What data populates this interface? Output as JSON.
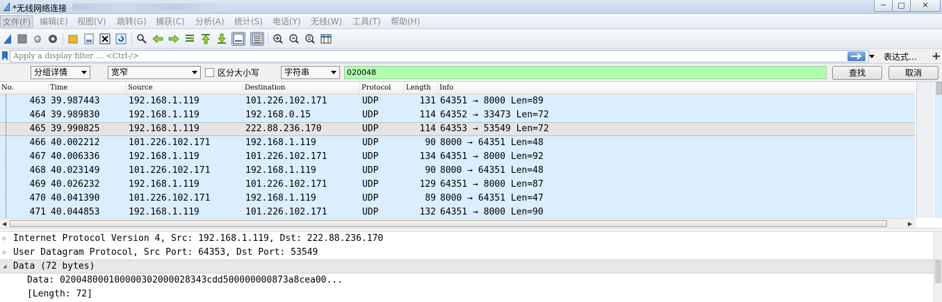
{
  "window": {
    "title": "*无线网络连接",
    "controls": {
      "minimize": "─",
      "maximize": "□",
      "close": "✕"
    }
  },
  "menubar": {
    "items": [
      "文件(F)",
      "编辑(E)",
      "视图(V)",
      "跳转(G)",
      "捕获(C)",
      "分析(A)",
      "统计(S)",
      "电话(Y)",
      "无线(W)",
      "工具(T)",
      "帮助(H)"
    ]
  },
  "toolbar": {
    "buttons": [
      "start-capture-icon",
      "stop-capture-icon",
      "restart-capture-icon",
      "capture-options-icon",
      "open-file-icon",
      "save-file-icon",
      "close-file-icon",
      "reload-icon",
      "find-packet-icon",
      "go-back-icon",
      "go-forward-icon",
      "go-to-packet-icon",
      "go-first-icon",
      "go-last-icon",
      "autoscroll-icon",
      "colorize-icon",
      "zoom-in-icon",
      "zoom-out-icon",
      "zoom-normal-icon",
      "resize-columns-icon"
    ]
  },
  "filter": {
    "placeholder": "Apply a display filter … <Ctrl-/>",
    "expression_label": "表达式…",
    "add_label": "+"
  },
  "find": {
    "search_in": "分组详情",
    "charset": "宽窄",
    "case_sensitive_label": "区分大小写",
    "search_type": "字符串",
    "search_value": "020048",
    "find_button": "查找",
    "cancel_button": "取消"
  },
  "packet_list": {
    "columns": [
      "No.",
      "Time",
      "Source",
      "Destination",
      "Protocol",
      "Length",
      "Info"
    ],
    "rows": [
      {
        "no": "463",
        "time": "39.987443",
        "src": "192.168.1.119",
        "dst": "101.226.102.171",
        "proto": "UDP",
        "len": "131",
        "info": "64351 → 8000 Len=89",
        "selected": false
      },
      {
        "no": "464",
        "time": "39.989830",
        "src": "192.168.1.119",
        "dst": "192.168.0.15",
        "proto": "UDP",
        "len": "114",
        "info": "64352 → 33473 Len=72",
        "selected": false
      },
      {
        "no": "465",
        "time": "39.990825",
        "src": "192.168.1.119",
        "dst": "222.88.236.170",
        "proto": "UDP",
        "len": "114",
        "info": "64353 → 53549 Len=72",
        "selected": true
      },
      {
        "no": "466",
        "time": "40.002212",
        "src": "101.226.102.171",
        "dst": "192.168.1.119",
        "proto": "UDP",
        "len": "90",
        "info": "8000 → 64351 Len=48",
        "selected": false
      },
      {
        "no": "467",
        "time": "40.006336",
        "src": "192.168.1.119",
        "dst": "101.226.102.171",
        "proto": "UDP",
        "len": "134",
        "info": "64351 → 8000 Len=92",
        "selected": false
      },
      {
        "no": "468",
        "time": "40.023149",
        "src": "101.226.102.171",
        "dst": "192.168.1.119",
        "proto": "UDP",
        "len": "90",
        "info": "8000 → 64351 Len=48",
        "selected": false
      },
      {
        "no": "469",
        "time": "40.026232",
        "src": "192.168.1.119",
        "dst": "101.226.102.171",
        "proto": "UDP",
        "len": "129",
        "info": "64351 → 8000 Len=87",
        "selected": false
      },
      {
        "no": "470",
        "time": "40.041390",
        "src": "101.226.102.171",
        "dst": "192.168.1.119",
        "proto": "UDP",
        "len": "89",
        "info": "8000 → 64351 Len=47",
        "selected": false
      },
      {
        "no": "471",
        "time": "40.044853",
        "src": "192.168.1.119",
        "dst": "101.226.102.171",
        "proto": "UDP",
        "len": "132",
        "info": "64351 → 8000 Len=90",
        "selected": false
      }
    ]
  },
  "details": {
    "rows": [
      {
        "text": "Internet Protocol Version 4, Src: 192.168.1.119, Dst: 222.88.236.170",
        "expander": "▷",
        "level": 0,
        "highlight": false
      },
      {
        "text": "User Datagram Protocol, Src Port: 64353, Dst Port: 53549",
        "expander": "▷",
        "level": 0,
        "highlight": false
      },
      {
        "text": "Data (72 bytes)",
        "expander": "◢",
        "level": 0,
        "highlight": true
      },
      {
        "text": "Data: 020048000100000302000028343cdd500000000873a8cea00...",
        "expander": "",
        "level": 1,
        "highlight": false
      },
      {
        "text": "[Length: 72]",
        "expander": "",
        "level": 1,
        "highlight": false
      }
    ]
  },
  "colors": {
    "row_udp": "#daeeff",
    "row_selected": "#e4e4e4",
    "search_field": "#afffaf"
  }
}
